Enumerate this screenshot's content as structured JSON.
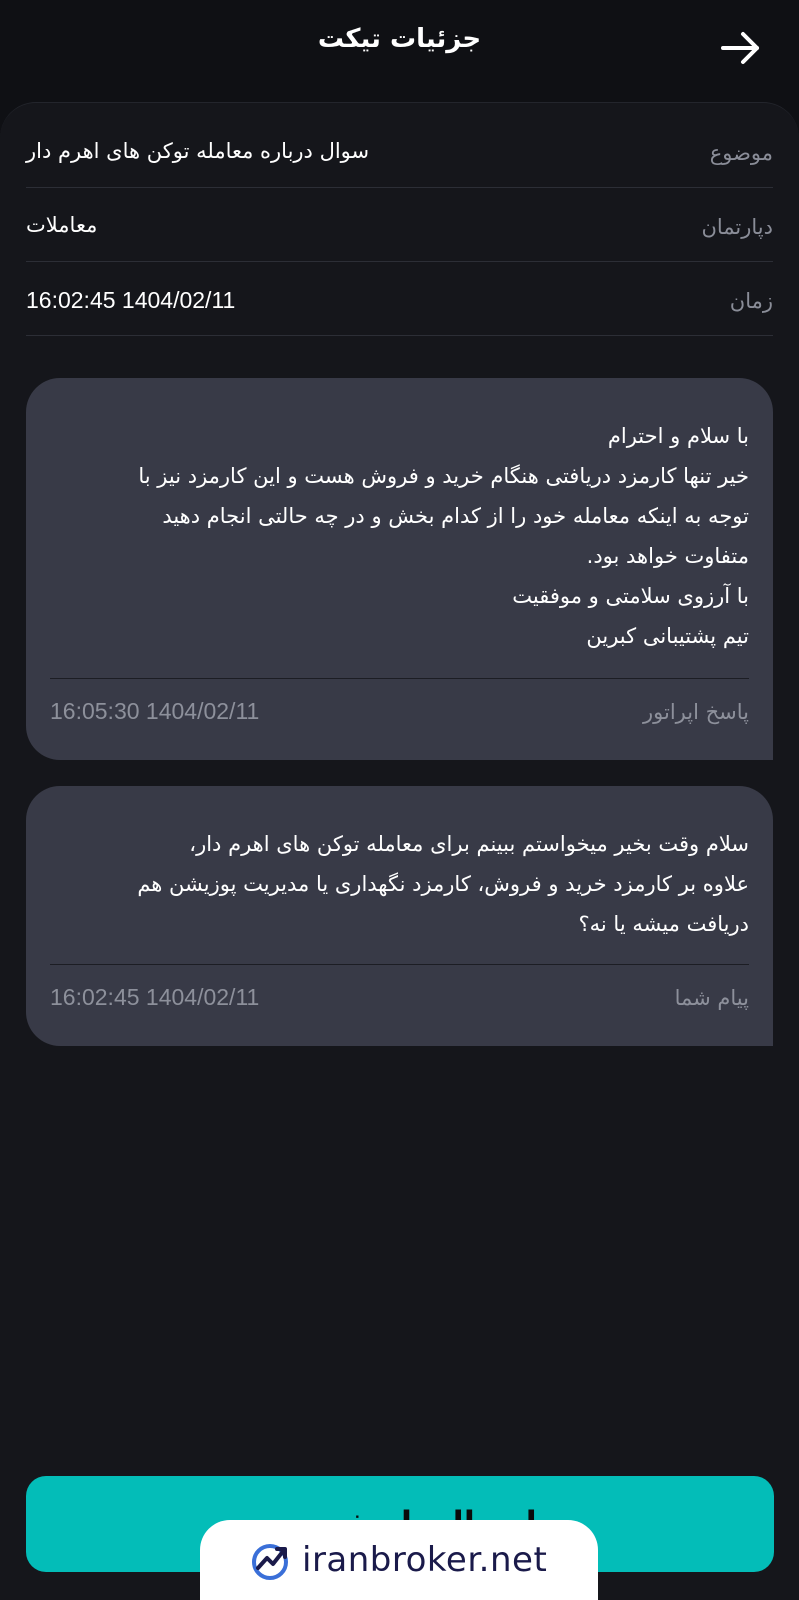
{
  "header": {
    "title": "جزئیات تیکت",
    "back_icon": "arrow-right-icon"
  },
  "ticket_info": {
    "subject": {
      "label": "موضوع",
      "value": "سوال درباره معامله توکن های اهرم دار"
    },
    "department": {
      "label": "دپارتمان",
      "value": "معاملات"
    },
    "time": {
      "label": "زمان",
      "value": "16:02:45 1404/02/11"
    }
  },
  "messages": [
    {
      "lines": [
        "با سلام و احترام",
        "خیر تنها کارمزد دریافتی هنگام خرید و فروش هست و این کارمزد نیز با",
        "توجه به اینکه معامله خود را از کدام بخش و در چه حالتی انجام دهید",
        "متفاوت خواهد بود.",
        "با آرزوی سلامتی و موفقیت",
        "تیم پشتیبانی کبرین"
      ],
      "sender": "پاسخ اپراتور",
      "time": "16:05:30 1404/02/11"
    },
    {
      "lines": [
        "سلام وقت بخیر میخواستم ببینم برای معامله توکن های اهرم دار،",
        "علاوه بر کارمزد خرید و فروش، کارمزد نگهداری یا مدیریت پوزیشن هم",
        "دریافت میشه یا نه؟"
      ],
      "sender": "پیام شما",
      "time": "16:02:45 1404/02/11"
    }
  ],
  "submit_button": {
    "label": "ارسال پاسخ جدید"
  },
  "watermark": {
    "text": "iranbroker.net",
    "icon": "trend-up-logo-icon"
  },
  "colors": {
    "background": "#0f1014",
    "message_bubble": "#383a47",
    "accent": "#03bdb8",
    "muted_text": "#8a8d98"
  }
}
